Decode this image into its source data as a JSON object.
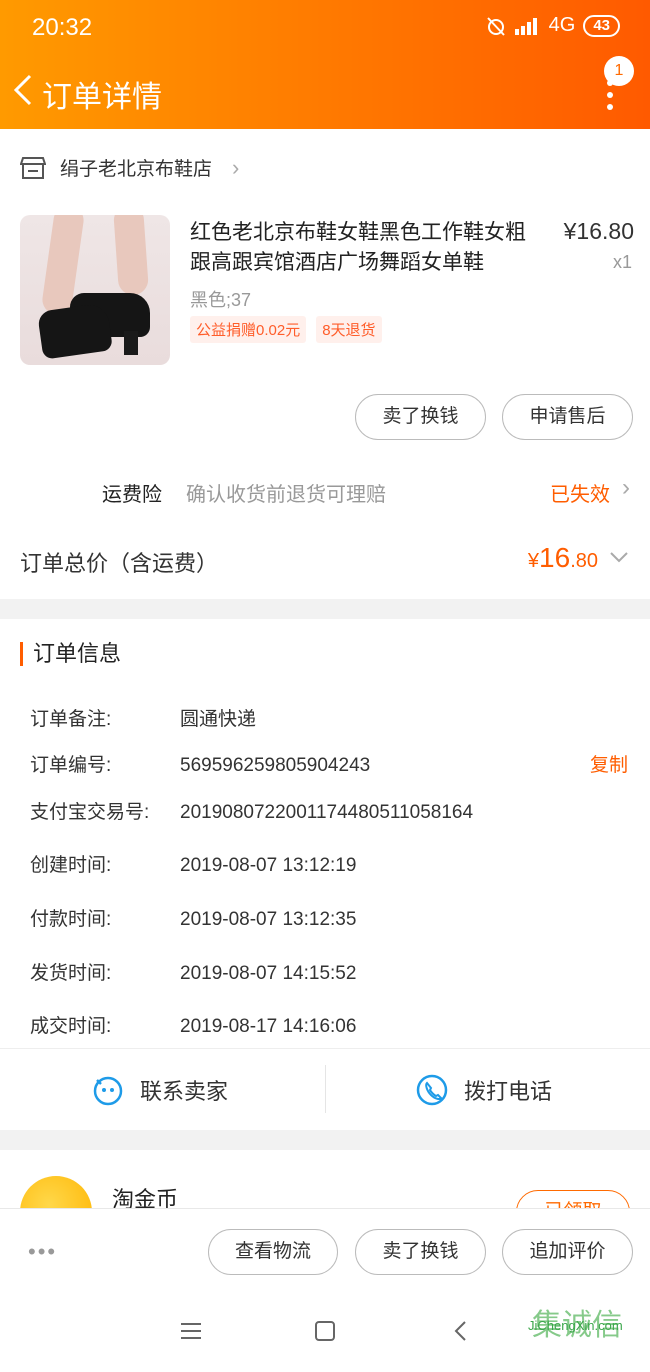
{
  "status_bar": {
    "time": "20:32",
    "network": "4G",
    "battery": "43"
  },
  "header": {
    "title": "订单详情",
    "notification_count": "1"
  },
  "shop": {
    "name": "绢子老北京布鞋店"
  },
  "product": {
    "name": "红色老北京布鞋女鞋黑色工作鞋女粗跟高跟宾馆酒店广场舞蹈女单鞋",
    "price": "¥16.80",
    "quantity": "x1",
    "spec": "黑色;37",
    "tags": [
      "公益捐赠0.02元",
      "8天退货"
    ]
  },
  "item_actions": {
    "sell_label": "卖了换钱",
    "aftersale_label": "申请售后"
  },
  "insurance": {
    "label": "运费险",
    "desc": "确认收货前退货可理赔",
    "status": "已失效"
  },
  "total": {
    "label": "订单总价（含运费）",
    "currency": "¥",
    "integer": "16",
    "decimal": ".80"
  },
  "order_info": {
    "title": "订单信息",
    "copy_label": "复制",
    "rows": [
      {
        "key": "订单备注:",
        "value": "圆通快递"
      },
      {
        "key": "订单编号:",
        "value": "569596259805904243"
      },
      {
        "key": "支付宝交易号:",
        "value": "2019080722001174480511058164"
      },
      {
        "key": "创建时间:",
        "value": "2019-08-07 13:12:19"
      },
      {
        "key": "付款时间:",
        "value": "2019-08-07 13:12:35"
      },
      {
        "key": "发货时间:",
        "value": "2019-08-07 14:15:52"
      },
      {
        "key": "成交时间:",
        "value": "2019-08-17 14:16:06"
      }
    ]
  },
  "contact": {
    "seller_label": "联系卖家",
    "call_label": "拨打电话"
  },
  "coin": {
    "label": "淘金币",
    "button": "已领取"
  },
  "bottom_bar": {
    "more": "•••",
    "logistics_label": "查看物流",
    "sell_label": "卖了换钱",
    "review_label": "追加评价"
  },
  "watermark": {
    "mark": "集诚信",
    "url": "JiChengXin.com"
  },
  "colors": {
    "accent": "#ff5d00",
    "header_start": "#ff9a00",
    "header_end": "#ff5a00"
  }
}
